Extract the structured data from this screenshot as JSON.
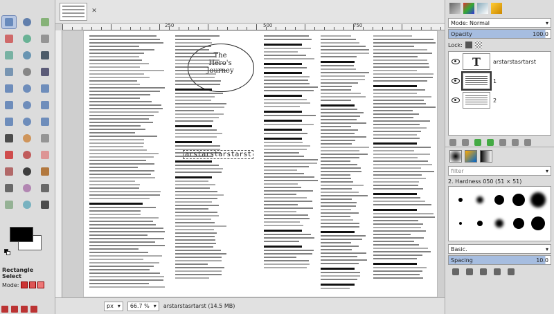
{
  "tabs": {
    "close": "✕"
  },
  "document": {
    "title_line1": "The",
    "title_line2": "Hero's",
    "title_line3": "Journey",
    "text_layer_content": "arstarstarstarst"
  },
  "rulers": {
    "h": [
      "250",
      "500",
      "750"
    ]
  },
  "status": {
    "unit": "px",
    "zoom": "66.7 %",
    "image_info": "arstarstasrtarst (14.5 MB)"
  },
  "tool_options": {
    "title": "Rectangle Select",
    "mode_label": "Mode:"
  },
  "layers_panel": {
    "mode_label": "Mode: Normal",
    "opacity_label": "Opacity",
    "opacity_value": "100.0",
    "opacity_fraction": 0.95,
    "lock_label": "Lock:",
    "layers": [
      {
        "name": "arstarstasrtarst",
        "type": "text"
      },
      {
        "name": "1",
        "type": "image"
      },
      {
        "name": "2",
        "type": "image"
      }
    ]
  },
  "brushes_panel": {
    "filter_placeholder": "filter",
    "brush_name": "2. Hardness 050 (51 × 51)",
    "preset": "Basic.",
    "spacing_label": "Spacing",
    "spacing_value": "10.0"
  },
  "colors": {
    "fg": "#000000",
    "bg": "#ffffff",
    "selection": "#b7c7e3"
  },
  "icons": [
    "rect-select-icon",
    "ellipse-select-icon",
    "lasso-icon",
    "fuzzy-select-icon",
    "color-select-icon",
    "scissors-icon",
    "foreground-select-icon",
    "paths-icon",
    "color-picker-icon",
    "zoom-icon",
    "measure-icon",
    "move-icon",
    "align-icon",
    "crop-icon",
    "rotate-icon",
    "scale-icon",
    "shear-icon",
    "perspective-icon",
    "flip-icon",
    "cage-icon",
    "warp-icon",
    "text-icon",
    "bucket-fill-icon",
    "gradient-icon",
    "pencil-icon",
    "paintbrush-icon",
    "eraser-icon",
    "airbrush-icon",
    "ink-icon",
    "mypaint-icon",
    "clone-icon",
    "heal-icon",
    "perspective-clone-icon",
    "smudge-icon",
    "blur-icon",
    "dodge-icon"
  ]
}
